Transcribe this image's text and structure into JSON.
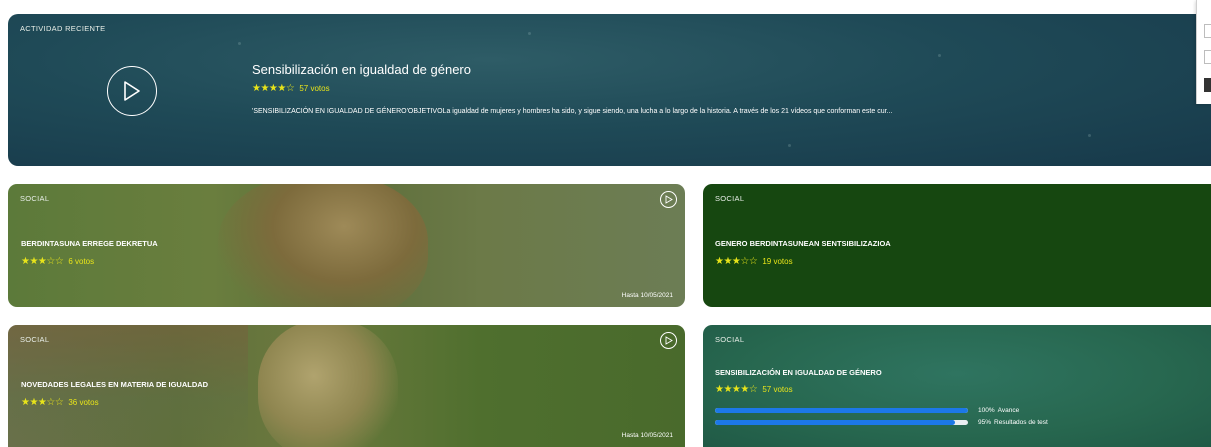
{
  "hero": {
    "tag": "ACTIVIDAD RECIENTE",
    "title": "Sensibilización en igualdad de género",
    "stars": "★★★★☆",
    "votes": "57 votos",
    "description": "'SENSIBILIZACIÓN EN IGUALDAD DE GÉNERO'OBJETIVOLa igualdad de mujeres y hombres ha sido, y sigue siendo, una lucha a lo largo de la historia. A través de los 21 vídeos que conforman este cur..."
  },
  "cards": [
    {
      "tag": "SOCIAL",
      "title": "BERDINTASUNA ERREGE DEKRETUA",
      "stars": "★★★☆☆",
      "votes": "6 votos",
      "date": "Hasta 10/05/2021"
    },
    {
      "tag": "SOCIAL",
      "title": "GENERO BERDINTASUNEAN SENTSIBILIZAZIOA",
      "stars": "★★★☆☆",
      "votes": "19 votos"
    },
    {
      "tag": "SOCIAL",
      "title": "NOVEDADES LEGALES EN MATERIA DE IGUALDAD",
      "stars": "★★★☆☆",
      "votes": "36 votos",
      "date": "Hasta 10/05/2021"
    },
    {
      "tag": "SOCIAL",
      "title": "SENSIBILIZACIÓN EN IGUALDAD DE GÉNERO",
      "stars": "★★★★☆",
      "votes": "57 votos",
      "progress": [
        {
          "value": 1.0,
          "pct": "100%",
          "label": "Avance"
        },
        {
          "value": 0.95,
          "pct": "95%",
          "label": "Resultados de test"
        }
      ]
    }
  ],
  "colors": {
    "star": "#e8e41a",
    "progress": "#1c78e8"
  },
  "icons": [
    "play-circle-icon",
    "star-icon"
  ]
}
